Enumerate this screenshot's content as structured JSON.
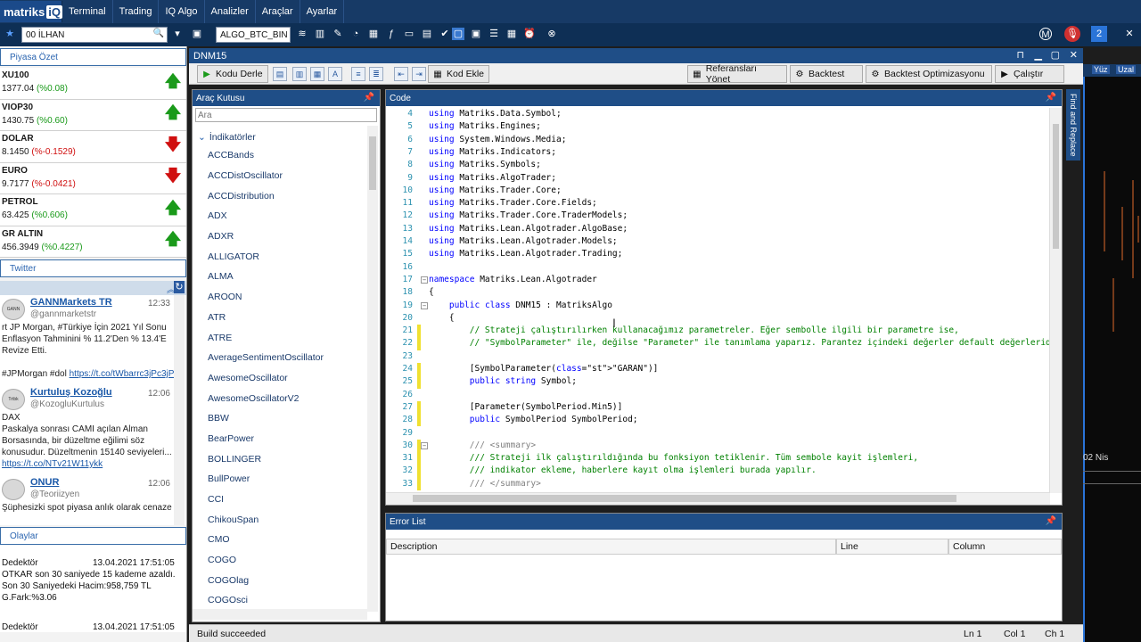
{
  "app": {
    "logo": "matriks",
    "logo_badge": "iQ"
  },
  "menu": [
    "Terminal",
    "Trading",
    "IQ Algo",
    "Analizler",
    "Araçlar",
    "Ayarlar"
  ],
  "toolbar": {
    "user_field": "00 İLHAN",
    "symbol_field": "ALGO_BTC_BIN",
    "badge_count": "2"
  },
  "left": {
    "tab_market": "Piyasa Özet",
    "markets": [
      {
        "name": "XU100",
        "price": "1377.04",
        "change": "(%0.08)",
        "dir": "up"
      },
      {
        "name": "VIOP30",
        "price": "1430.75",
        "change": "(%0.60)",
        "dir": "up"
      },
      {
        "name": "DOLAR",
        "price": "8.1450",
        "change": "(%-0.1529)",
        "dir": "down"
      },
      {
        "name": "EURO",
        "price": "9.7177",
        "change": "(%-0.0421)",
        "dir": "down"
      },
      {
        "name": "PETROL",
        "price": "63.425",
        "change": "(%0.606)",
        "dir": "up"
      },
      {
        "name": "GR ALTIN",
        "price": "456.3949",
        "change": "(%0.4227)",
        "dir": "up"
      }
    ],
    "tab_twitter": "Twitter",
    "tweets": [
      {
        "avatar": "GANN",
        "name": "GANNMarkets TR",
        "handle": "@gannmarketstr",
        "time": "12:33",
        "text": "rt JP Morgan, #Türkiye İçin 2021 Yıl Sonu Enflasyon Tahminini % 11.2'Den % 13.4'E Revize Etti.\n\n#JPMorgan #dol",
        "link": "https://t.co/tWbarrc3jPc3jP"
      },
      {
        "avatar": "Trtbk",
        "name": "Kurtuluş Kozoğlu",
        "handle": "@KozogluKurtulus",
        "time": "12:06",
        "text": "DAX\nPaskalya sonrası CAMI açılan Alman Borsasında, bir düzeltme eğilimi söz konusudur. Düzeltmenin 15140 seviyeleri...",
        "link": "https://t.co/NTv21W11ykk"
      },
      {
        "avatar": "",
        "name": "ONUR",
        "handle": "@Teoriizyen",
        "time": "12:06",
        "text": "Şüphesizki spot piyasa anlık olarak cenaze",
        "link": ""
      }
    ],
    "tab_olaylar": "Olaylar",
    "events": [
      {
        "title": "Dedektör",
        "date": "13.04.2021 17:51:05",
        "text": "OTKAR son 30 saniyede 15 kademe azaldı. Son 30 Saniyedeki Hacim:958,759 TL G.Fark:%3.06"
      },
      {
        "title": "Dedektör",
        "date": "13.04.2021 17:51:05",
        "text": ""
      }
    ]
  },
  "toolbox": {
    "title": "Araç Kutusu",
    "search_placeholder": "Ara",
    "group": "İndikatörler",
    "items": [
      "ACCBands",
      "ACCDistOscillator",
      "ACCDistribution",
      "ADX",
      "ADXR",
      "ALLIGATOR",
      "ALMA",
      "AROON",
      "ATR",
      "ATRE",
      "AverageSentimentOscillator",
      "AwesomeOscillator",
      "AwesomeOscillatorV2",
      "BBW",
      "BearPower",
      "BOLLINGER",
      "BullPower",
      "CCI",
      "ChikouSpan",
      "CMO",
      "COGO",
      "COGOlag",
      "COGOsci"
    ]
  },
  "editor": {
    "window_title": "DNM15",
    "btn_compile": "Kodu Derle",
    "btn_add_code": "Kod Ekle",
    "btn_ref": "Referansları Yönet",
    "btn_backtest": "Backtest",
    "btn_opt": "Backtest Optimizasyonu",
    "btn_run": "Çalıştır",
    "code_title": "Code",
    "find_replace": "Find and Replace",
    "lines": [
      {
        "n": "4",
        "t": "using Matriks.Data.Symbol;",
        "k": "using"
      },
      {
        "n": "5",
        "t": "using Matriks.Engines;",
        "k": "using"
      },
      {
        "n": "6",
        "t": "using System.Windows.Media;",
        "k": "using"
      },
      {
        "n": "7",
        "t": "using Matriks.Indicators;",
        "k": "using"
      },
      {
        "n": "8",
        "t": "using Matriks.Symbols;",
        "k": "using"
      },
      {
        "n": "9",
        "t": "using Matriks.AlgoTrader;",
        "k": "using"
      },
      {
        "n": "10",
        "t": "using Matriks.Trader.Core;",
        "k": "using"
      },
      {
        "n": "11",
        "t": "using Matriks.Trader.Core.Fields;",
        "k": "using"
      },
      {
        "n": "12",
        "t": "using Matriks.Trader.Core.TraderModels;",
        "k": "using"
      },
      {
        "n": "13",
        "t": "using Matriks.Lean.Algotrader.AlgoBase;",
        "k": "using"
      },
      {
        "n": "14",
        "t": "using Matriks.Lean.Algotrader.Models;",
        "k": "using"
      },
      {
        "n": "15",
        "t": "using Matriks.Lean.Algotrader.Trading;",
        "k": "using"
      },
      {
        "n": "16",
        "t": "",
        "k": ""
      },
      {
        "n": "17",
        "t": "namespace Matriks.Lean.Algotrader",
        "k": "namespace"
      },
      {
        "n": "18",
        "t": "{",
        "k": ""
      },
      {
        "n": "19",
        "t": "    public class DNM15 : MatriksAlgo",
        "k": "class"
      },
      {
        "n": "20",
        "t": "    {",
        "k": ""
      },
      {
        "n": "21",
        "t": "        // Strateji çalıştırılırken kullanacağımız parametreler. Eğer sembolle ilgili bir parametre ise,",
        "k": "comment"
      },
      {
        "n": "22",
        "t": "        // \"SymbolParameter\" ile, değilse \"Parameter\" ile tanımlama yaparız. Parantez içindeki değerler default değerleridir.",
        "k": "comment"
      },
      {
        "n": "23",
        "t": "",
        "k": ""
      },
      {
        "n": "24",
        "t": "        [SymbolParameter(\"GARAN\")]",
        "k": "attr"
      },
      {
        "n": "25",
        "t": "        public string Symbol;",
        "k": "pubstr"
      },
      {
        "n": "26",
        "t": "",
        "k": ""
      },
      {
        "n": "27",
        "t": "        [Parameter(SymbolPeriod.Min5)]",
        "k": ""
      },
      {
        "n": "28",
        "t": "        public SymbolPeriod SymbolPeriod;",
        "k": "pub"
      },
      {
        "n": "29",
        "t": "",
        "k": ""
      },
      {
        "n": "30",
        "t": "        /// <summary>",
        "k": "doc"
      },
      {
        "n": "31",
        "t": "        /// Strateji ilk çalıştırıldığında bu fonksiyon tetiklenir. Tüm sembole kayit işlemleri,",
        "k": "comment"
      },
      {
        "n": "32",
        "t": "        /// indikator ekleme, haberlere kayıt olma işlemleri burada yapılır.",
        "k": "comment"
      },
      {
        "n": "33",
        "t": "        /// </summary>",
        "k": "doc"
      }
    ],
    "error_title": "Error List",
    "err_cols": [
      "Description",
      "Line",
      "Column"
    ],
    "status": "Build succeeded",
    "ln": "Ln 1",
    "col": "Col 1",
    "ch": "Ch 1"
  },
  "chart": {
    "date_label": "02 Nis",
    "tabs": [
      "Yüz",
      "Uzal"
    ]
  }
}
